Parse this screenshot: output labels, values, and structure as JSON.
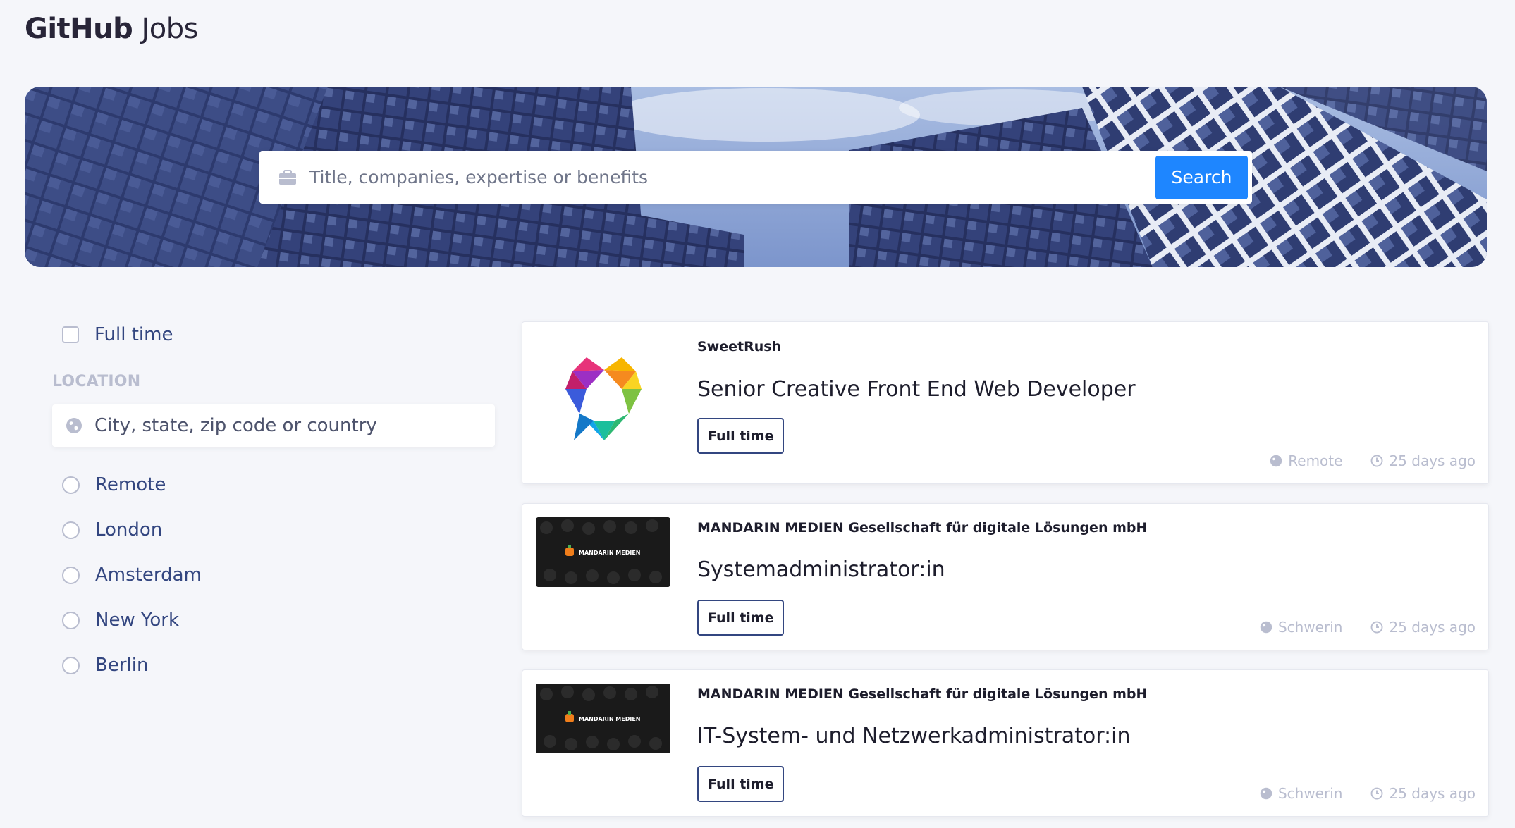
{
  "header": {
    "brand_bold": "GitHub",
    "brand_light": "Jobs"
  },
  "search": {
    "placeholder": "Title, companies, expertise or benefits",
    "value": "",
    "button_label": "Search",
    "icon": "briefcase-icon"
  },
  "filters": {
    "full_time_label": "Full time",
    "full_time_checked": false,
    "location_heading": "LOCATION",
    "location_placeholder": "City, state, zip code or country",
    "location_icon": "globe-icon",
    "locations": [
      {
        "label": "Remote"
      },
      {
        "label": "London"
      },
      {
        "label": "Amsterdam"
      },
      {
        "label": "New York"
      },
      {
        "label": "Berlin"
      }
    ]
  },
  "jobs": [
    {
      "company": "SweetRush",
      "title": "Senior Creative Front End Web Developer",
      "type": "Full time",
      "location": "Remote",
      "posted": "25 days ago"
    },
    {
      "company": "MANDARIN MEDIEN Gesellschaft für digitale Lösungen mbH",
      "title": "Systemadministrator:in",
      "type": "Full time",
      "location": "Schwerin",
      "posted": "25 days ago",
      "logo_text": "MANDARIN MEDIEN"
    },
    {
      "company": "MANDARIN MEDIEN Gesellschaft für digitale Lösungen mbH",
      "title": "IT-System- und Netzwerkadministrator:in",
      "type": "Full time",
      "location": "Schwerin",
      "posted": "25 days ago",
      "logo_text": "MANDARIN MEDIEN"
    }
  ],
  "colors": {
    "accent": "#1e86ff",
    "text": "#334680",
    "muted": "#b9bdcf",
    "background": "#f5f6fa"
  }
}
